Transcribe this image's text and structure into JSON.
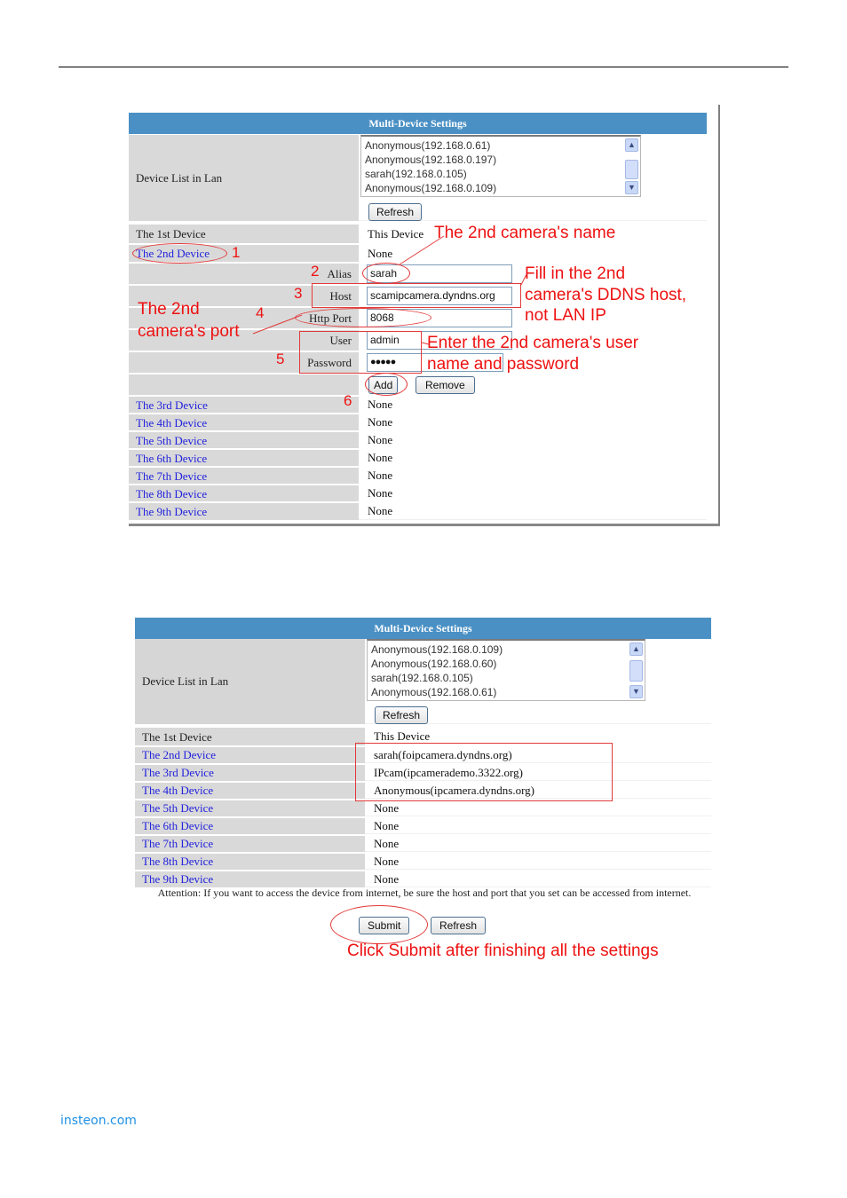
{
  "page": {
    "footer_link": "insteon.com"
  },
  "screenshot1": {
    "header": "Multi-Device Settings",
    "device_list_label": "Device List in Lan",
    "device_list_options": [
      "Anonymous(192.168.0.61)",
      "Anonymous(192.168.0.197)",
      "sarah(192.168.0.105)",
      "Anonymous(192.168.0.109)"
    ],
    "refresh_label": "Refresh",
    "first_device_label": "The 1st Device",
    "first_device_value": "This Device",
    "second_device_label": "The 2nd Device",
    "second_device_value": "None",
    "form": {
      "alias_label": "Alias",
      "alias_value": "sarah",
      "host_label": "Host",
      "host_value": "scamipcamera.dyndns.org",
      "port_label": "Http Port",
      "port_value": "8068",
      "user_label": "User",
      "user_value": "admin",
      "password_label": "Password",
      "password_value": "●●●●●",
      "add_label": "Add",
      "remove_label": "Remove"
    },
    "devices": [
      {
        "label": "The 3rd Device",
        "value": "None"
      },
      {
        "label": "The 4th Device",
        "value": "None"
      },
      {
        "label": "The 5th Device",
        "value": "None"
      },
      {
        "label": "The 6th Device",
        "value": "None"
      },
      {
        "label": "The 7th Device",
        "value": "None"
      },
      {
        "label": "The 8th Device",
        "value": "None"
      },
      {
        "label": "The 9th Device",
        "value": "None"
      }
    ],
    "annotations": {
      "n1": "1",
      "n2": "2",
      "n3": "3",
      "n4": "4",
      "n5": "5",
      "n6": "6",
      "camera_name": "The 2nd camera's name",
      "ddns_line1": "Fill in the 2nd",
      "ddns_line2": "camera's DDNS host,",
      "ddns_line3": "not LAN IP",
      "port_line1": "The 2nd",
      "port_line2": "camera's port",
      "user_line1": "Enter the 2nd camera's user",
      "user_line2": "name and password"
    }
  },
  "screenshot2": {
    "header": "Multi-Device Settings",
    "device_list_label": "Device List in Lan",
    "device_list_options": [
      "Anonymous(192.168.0.109)",
      "Anonymous(192.168.0.60)",
      "sarah(192.168.0.105)",
      "Anonymous(192.168.0.61)"
    ],
    "refresh_label": "Refresh",
    "devices": [
      {
        "label": "The 1st Device",
        "value": "This Device"
      },
      {
        "label": "The 2nd Device",
        "value": "sarah(foipcamera.dyndns.org)"
      },
      {
        "label": "The 3rd Device",
        "value": "IPcam(ipcamerademo.3322.org)"
      },
      {
        "label": "The 4th Device",
        "value": "Anonymous(ipcamera.dyndns.org)"
      },
      {
        "label": "The 5th Device",
        "value": "None"
      },
      {
        "label": "The 6th Device",
        "value": "None"
      },
      {
        "label": "The 7th Device",
        "value": "None"
      },
      {
        "label": "The 8th Device",
        "value": "None"
      },
      {
        "label": "The 9th Device",
        "value": "None"
      }
    ],
    "attention": "Attention: If you want to access the device from internet, be sure the host and port that you set can be accessed from internet.",
    "submit_label": "Submit",
    "refresh2_label": "Refresh",
    "annotation_submit": "Click Submit after finishing all the settings"
  }
}
